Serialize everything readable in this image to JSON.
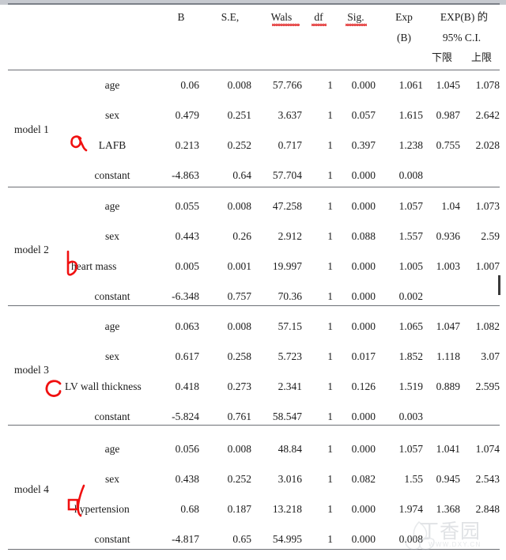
{
  "document": {
    "type": "statistics-table",
    "description": "SPSS logistic regression output table with four models",
    "watermark": {
      "text": "丁香园",
      "url": "WWW.DXY.CN"
    }
  },
  "table": {
    "columns": [
      {
        "key": "model",
        "label": ""
      },
      {
        "key": "var",
        "label": ""
      },
      {
        "key": "b",
        "label": "B",
        "spellcheck_underline": false
      },
      {
        "key": "se",
        "label": "S.E,",
        "spellcheck_underline": false
      },
      {
        "key": "wals",
        "label": "Wals",
        "spellcheck_underline": true
      },
      {
        "key": "df",
        "label": "df",
        "spellcheck_underline": true
      },
      {
        "key": "sig",
        "label": "Sig.",
        "spellcheck_underline": true
      },
      {
        "key": "expb",
        "label": "Exp",
        "label2": "(B)",
        "spellcheck_underline": false
      },
      {
        "key": "lower",
        "label": "下限"
      },
      {
        "key": "upper",
        "label": "上限"
      }
    ],
    "ci_header": {
      "line1": "EXP(B) 的",
      "line2": "95% C.I.",
      "lower": "下限",
      "upper": "上限"
    },
    "models": [
      {
        "name": "model 1",
        "mark": "alpha",
        "marked_row": 2,
        "rows": [
          {
            "var": "age",
            "b": "0.06",
            "se": "0.008",
            "wals": "57.766",
            "df": "1",
            "sig": "0.000",
            "expb": "1.061",
            "lower": "1.045",
            "upper": "1.078"
          },
          {
            "var": "sex",
            "b": "0.479",
            "se": "0.251",
            "wals": "3.637",
            "df": "1",
            "sig": "0.057",
            "expb": "1.615",
            "lower": "0.987",
            "upper": "2.642"
          },
          {
            "var": "LAFB",
            "b": "0.213",
            "se": "0.252",
            "wals": "0.717",
            "df": "1",
            "sig": "0.397",
            "expb": "1.238",
            "lower": "0.755",
            "upper": "2.028"
          },
          {
            "var": "constant",
            "b": "-4.863",
            "se": "0.64",
            "wals": "57.704",
            "df": "1",
            "sig": "0.000",
            "expb": "0.008",
            "lower": "",
            "upper": ""
          }
        ]
      },
      {
        "name": "model 2",
        "mark": "b",
        "marked_row": 2,
        "rows": [
          {
            "var": "age",
            "b": "0.055",
            "se": "0.008",
            "wals": "47.258",
            "df": "1",
            "sig": "0.000",
            "expb": "1.057",
            "lower": "1.04",
            "upper": "1.073"
          },
          {
            "var": "sex",
            "b": "0.443",
            "se": "0.26",
            "wals": "2.912",
            "df": "1",
            "sig": "0.088",
            "expb": "1.557",
            "lower": "0.936",
            "upper": "2.59"
          },
          {
            "var": "heart mass",
            "b": "0.005",
            "se": "0.001",
            "wals": "19.997",
            "df": "1",
            "sig": "0.000",
            "expb": "1.005",
            "lower": "1.003",
            "upper": "1.007"
          },
          {
            "var": "constant",
            "b": "-6.348",
            "se": "0.757",
            "wals": "70.36",
            "df": "1",
            "sig": "0.000",
            "expb": "0.002",
            "lower": "",
            "upper": ""
          }
        ]
      },
      {
        "name": "model 3",
        "mark": "c",
        "marked_row": 2,
        "rows": [
          {
            "var": "age",
            "b": "0.063",
            "se": "0.008",
            "wals": "57.15",
            "df": "1",
            "sig": "0.000",
            "expb": "1.065",
            "lower": "1.047",
            "upper": "1.082"
          },
          {
            "var": "sex",
            "b": "0.617",
            "se": "0.258",
            "wals": "5.723",
            "df": "1",
            "sig": "0.017",
            "expb": "1.852",
            "lower": "1.118",
            "upper": "3.07"
          },
          {
            "var": "LV wall thickness",
            "b": "0.418",
            "se": "0.273",
            "wals": "2.341",
            "df": "1",
            "sig": "0.126",
            "expb": "1.519",
            "lower": "0.889",
            "upper": "2.595"
          },
          {
            "var": "constant",
            "b": "-5.824",
            "se": "0.761",
            "wals": "58.547",
            "df": "1",
            "sig": "0.000",
            "expb": "0.003",
            "lower": "",
            "upper": ""
          }
        ]
      },
      {
        "name": "model 4",
        "mark": "d",
        "marked_row": 2,
        "rows": [
          {
            "var": "age",
            "b": "0.056",
            "se": "0.008",
            "wals": "48.84",
            "df": "1",
            "sig": "0.000",
            "expb": "1.057",
            "lower": "1.041",
            "upper": "1.074"
          },
          {
            "var": "sex",
            "b": "0.438",
            "se": "0.252",
            "wals": "3.016",
            "df": "1",
            "sig": "0.082",
            "expb": "1.55",
            "lower": "0.945",
            "upper": "2.543"
          },
          {
            "var": "hypertension",
            "b": "0.68",
            "se": "0.187",
            "wals": "13.218",
            "df": "1",
            "sig": "0.000",
            "expb": "1.974",
            "lower": "1.368",
            "upper": "2.848"
          },
          {
            "var": "constant",
            "b": "-4.817",
            "se": "0.65",
            "wals": "54.995",
            "df": "1",
            "sig": "0.000",
            "expb": "0.008",
            "lower": "",
            "upper": ""
          }
        ]
      }
    ]
  }
}
